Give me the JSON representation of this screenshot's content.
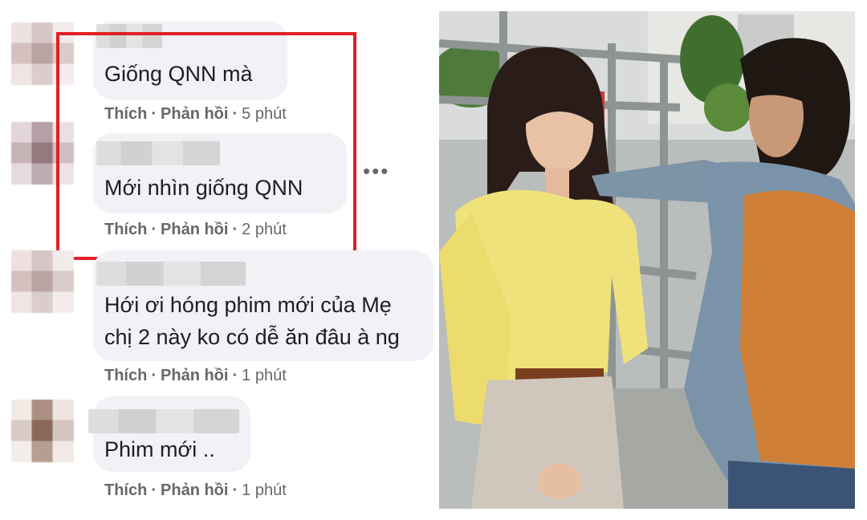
{
  "comments": [
    {
      "author": "",
      "text": "Giống QNN mà",
      "like_label": "Thích",
      "reply_label": "Phản hồi",
      "time": "5 phút"
    },
    {
      "author": "",
      "text": "Mới nhìn giống QNN",
      "like_label": "Thích",
      "reply_label": "Phản hồi",
      "time": "2 phút"
    },
    {
      "author": "",
      "text_line1": "Hới ơi hóng phim mới của Mẹ",
      "text_line2": "chị 2 này ko có dễ ăn đâu à ng",
      "like_label": "Thích",
      "reply_label": "Phản hồi",
      "time": "1 phút"
    },
    {
      "author": "",
      "text": "Phim mới ..",
      "like_label": "Thích",
      "reply_label": "Phản hồi",
      "time": "1 phút"
    }
  ],
  "more_options": "•••",
  "colors": {
    "highlight_border": "#e02124",
    "bubble_bg": "#f0f2f5",
    "meta_text": "#65676b",
    "comment_text": "#1c1e21"
  },
  "photo": {
    "description_icon": "photo-two-actors"
  }
}
